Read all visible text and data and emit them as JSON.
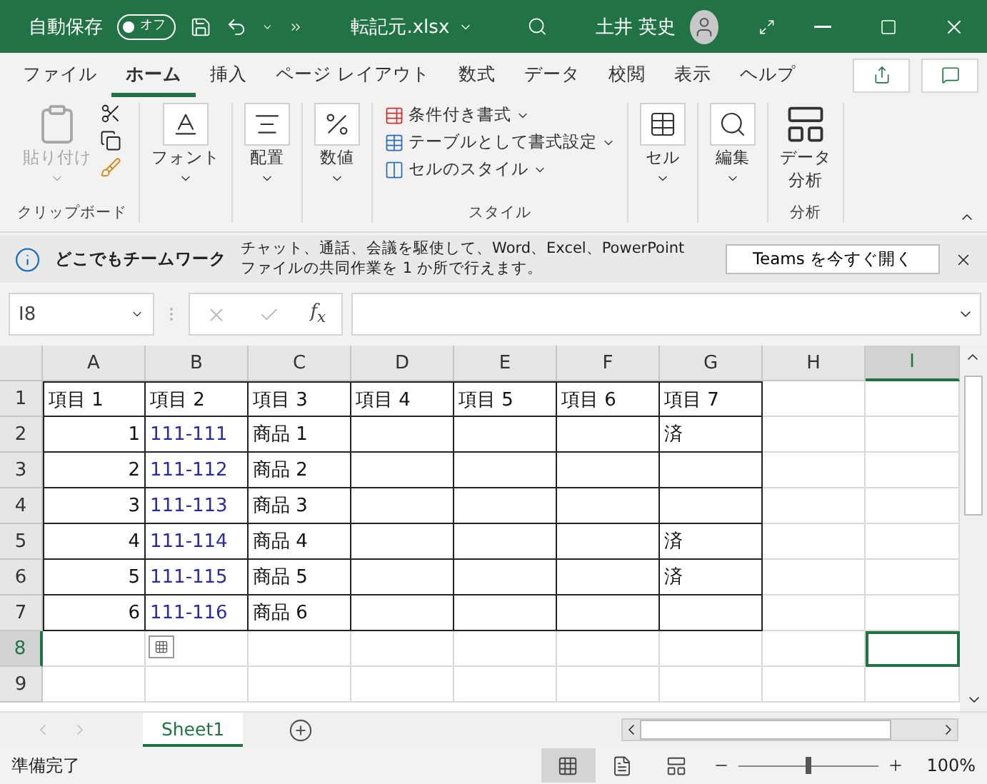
{
  "title_bar": {
    "autosave_label": "自動保存",
    "autosave": {
      "label": "オフ",
      "on": false
    },
    "filename": "転記元.xlsx",
    "user": "土井 英史"
  },
  "ribbon_tabs": [
    {
      "label": "ファイル",
      "selected": false
    },
    {
      "label": "ホーム",
      "selected": true
    },
    {
      "label": "挿入",
      "selected": false
    },
    {
      "label": "ページ レイアウト",
      "selected": false
    },
    {
      "label": "数式",
      "selected": false
    },
    {
      "label": "データ",
      "selected": false
    },
    {
      "label": "校閲",
      "selected": false
    },
    {
      "label": "表示",
      "selected": false
    },
    {
      "label": "ヘルプ",
      "selected": false
    }
  ],
  "ribbon": {
    "clipboard": {
      "paste": "貼り付け",
      "paste_disabled": true,
      "label": "クリップボード"
    },
    "font": "フォント",
    "alignment": "配置",
    "number": "数値",
    "styles": {
      "items": [
        "条件付き書式",
        "テーブルとして書式設定",
        "セルのスタイル"
      ],
      "label": "スタイル"
    },
    "cells": "セル",
    "editing": "編集",
    "analysis": {
      "button": [
        "データ",
        "分析"
      ],
      "label": "分析"
    }
  },
  "info_bar": {
    "title": "どこでもチームワーク",
    "message": "チャット、通話、会議を駆使して、Word、Excel、PowerPoint ファイルの共同作業を 1 か所で行えます。",
    "button": "Teams を今すぐ開く"
  },
  "formula_bar": {
    "name_box": "I8",
    "fx": "f$_{x}$"
  },
  "columns": [
    {
      "label": "A",
      "selected": false
    },
    {
      "label": "B",
      "selected": false
    },
    {
      "label": "C",
      "selected": false
    },
    {
      "label": "D",
      "selected": false
    },
    {
      "label": "E",
      "selected": false
    },
    {
      "label": "F",
      "selected": false
    },
    {
      "label": "G",
      "selected": false
    },
    {
      "label": "H",
      "selected": false
    },
    {
      "label": "I",
      "selected": true
    }
  ],
  "rows": [
    {
      "label": "1",
      "selected": false,
      "cells": [
        {
          "kind": "text",
          "text": "項目 1"
        },
        {
          "kind": "text",
          "text": "項目 2"
        },
        {
          "kind": "text",
          "text": "項目 3"
        },
        {
          "kind": "text",
          "text": "項目 4"
        },
        {
          "kind": "text",
          "text": "項目 5"
        },
        {
          "kind": "text",
          "text": "項目 6"
        },
        {
          "kind": "text",
          "text": "項目 7"
        }
      ]
    },
    {
      "label": "2",
      "selected": false,
      "cells": [
        {
          "kind": "number",
          "text": "1"
        },
        {
          "kind": "code",
          "text": "111-111"
        },
        {
          "kind": "text",
          "text": "商品 1"
        },
        {
          "kind": "empty"
        },
        {
          "kind": "empty"
        },
        {
          "kind": "empty"
        },
        {
          "kind": "text",
          "text": "済"
        }
      ]
    },
    {
      "label": "3",
      "selected": false,
      "cells": [
        {
          "kind": "number",
          "text": "2"
        },
        {
          "kind": "code",
          "text": "111-112"
        },
        {
          "kind": "text",
          "text": "商品 2"
        },
        {
          "kind": "empty"
        },
        {
          "kind": "empty"
        },
        {
          "kind": "empty"
        },
        {
          "kind": "empty"
        }
      ]
    },
    {
      "label": "4",
      "selected": false,
      "cells": [
        {
          "kind": "number",
          "text": "3"
        },
        {
          "kind": "code",
          "text": "111-113"
        },
        {
          "kind": "text",
          "text": "商品 3"
        },
        {
          "kind": "empty"
        },
        {
          "kind": "empty"
        },
        {
          "kind": "empty"
        },
        {
          "kind": "empty"
        }
      ]
    },
    {
      "label": "5",
      "selected": false,
      "cells": [
        {
          "kind": "number",
          "text": "4"
        },
        {
          "kind": "code",
          "text": "111-114"
        },
        {
          "kind": "text",
          "text": "商品 4"
        },
        {
          "kind": "empty"
        },
        {
          "kind": "empty"
        },
        {
          "kind": "empty"
        },
        {
          "kind": "text",
          "text": "済"
        }
      ]
    },
    {
      "label": "6",
      "selected": false,
      "cells": [
        {
          "kind": "number",
          "text": "5"
        },
        {
          "kind": "code",
          "text": "111-115"
        },
        {
          "kind": "text",
          "text": "商品 5"
        },
        {
          "kind": "empty"
        },
        {
          "kind": "empty"
        },
        {
          "kind": "empty"
        },
        {
          "kind": "text",
          "text": "済"
        }
      ]
    },
    {
      "label": "7",
      "selected": false,
      "cells": [
        {
          "kind": "number",
          "text": "6"
        },
        {
          "kind": "code",
          "text": "111-116"
        },
        {
          "kind": "text",
          "text": "商品 6"
        },
        {
          "kind": "empty"
        },
        {
          "kind": "empty"
        },
        {
          "kind": "empty"
        },
        {
          "kind": "empty"
        }
      ]
    },
    {
      "label": "8",
      "selected": true,
      "cells": []
    },
    {
      "label": "9",
      "selected": false,
      "cells": []
    }
  ],
  "sheet_tabs": [
    {
      "label": "Sheet1",
      "selected": true
    }
  ],
  "status_bar": {
    "status": "準備完了",
    "zoom": "100%",
    "zoom_level": {
      "level": 0.5
    }
  }
}
